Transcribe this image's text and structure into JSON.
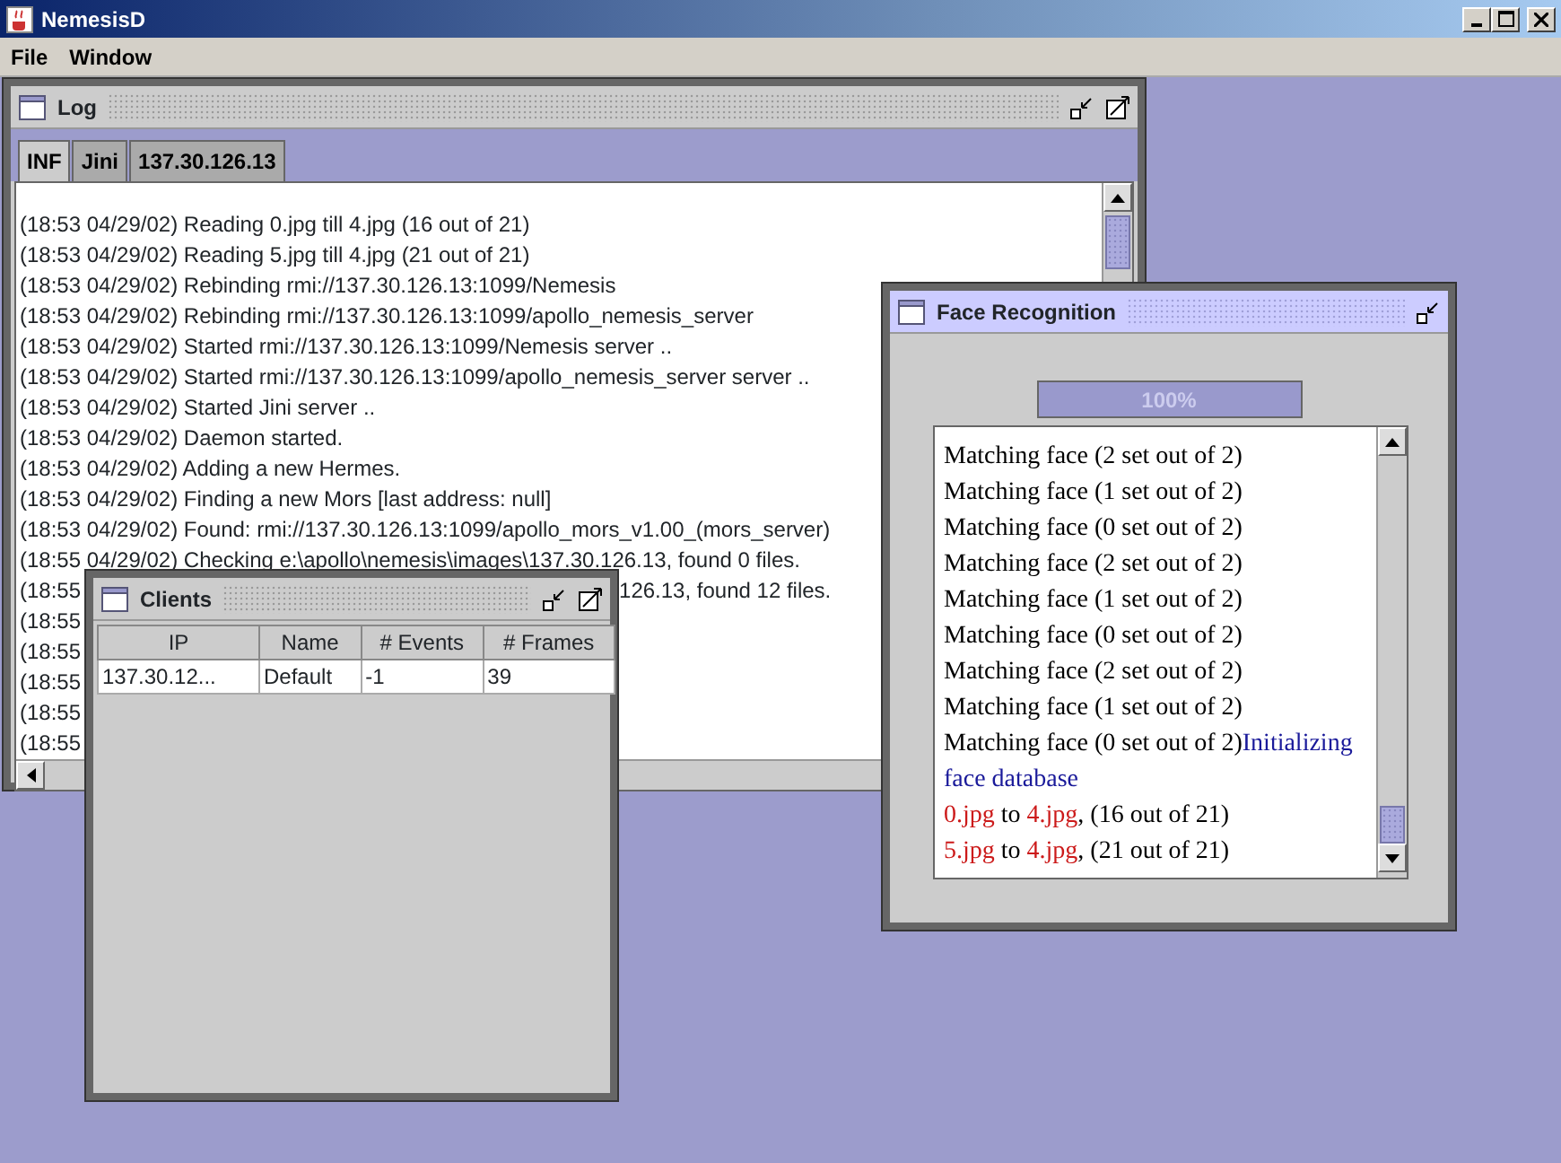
{
  "app": {
    "title": "NemesisD"
  },
  "menu": [
    "File",
    "Window"
  ],
  "log_window": {
    "title": "Log",
    "tabs": [
      {
        "label": "INF",
        "selected": true
      },
      {
        "label": "Jini",
        "selected": false
      },
      {
        "label": "137.30.126.13",
        "selected": false
      }
    ],
    "lines": [
      {
        "text": "(18:53 04/29/02) Reading 0.jpg till 4.jpg (16 out of 21)"
      },
      {
        "text": "(18:53 04/29/02) Reading 5.jpg till 4.jpg (21 out of 21)"
      },
      {
        "text": "(18:53 04/29/02) Rebinding rmi://137.30.126.13:1099/Nemesis"
      },
      {
        "text": "(18:53 04/29/02) Rebinding rmi://137.30.126.13:1099/apollo_nemesis_server"
      },
      {
        "text": "(18:53 04/29/02) Started rmi://137.30.126.13:1099/Nemesis server .."
      },
      {
        "text": "(18:53 04/29/02) Started rmi://137.30.126.13:1099/apollo_nemesis_server server .."
      },
      {
        "text": "(18:53 04/29/02) Started Jini server .."
      },
      {
        "text": "(18:53 04/29/02) Daemon started."
      },
      {
        "text": "(18:53 04/29/02) Adding a new Hermes."
      },
      {
        "text": "(18:53 04/29/02) Finding a new Mors [last address: null]"
      },
      {
        "text": "(18:53 04/29/02) Found: rmi://137.30.126.13:1099/apollo_mors_v1.00_(mors_server)"
      },
      {
        "text": "(18:55 04/29/02) Checking e:\\apollo\\nemesis\\images\\137.30.126.13, found 0 files."
      },
      {
        "text": "(18:55",
        "tail": "126.13, found 12 files."
      },
      {
        "text": "(18:55"
      },
      {
        "text": "(18:55"
      },
      {
        "text": "(18:55"
      },
      {
        "text": "(18:55"
      },
      {
        "text": "(18:55"
      }
    ]
  },
  "clients_window": {
    "title": "Clients",
    "columns": [
      "IP",
      "Name",
      "# Events",
      "# Frames"
    ],
    "rows": [
      [
        "137.30.12...",
        "Default",
        "-1",
        "39"
      ]
    ]
  },
  "face_window": {
    "title": "Face Recognition",
    "progress": {
      "level": 1,
      "label": "100%"
    },
    "messages": [
      {
        "segments": [
          {
            "text": "Matching face (2 set out of 2)",
            "color": "#000000"
          }
        ]
      },
      {
        "segments": [
          {
            "text": "Matching face (1 set out of 2)",
            "color": "#000000"
          }
        ]
      },
      {
        "segments": [
          {
            "text": "Matching face (0 set out of 2)",
            "color": "#000000"
          }
        ]
      },
      {
        "segments": [
          {
            "text": "Matching face (2 set out of 2)",
            "color": "#000000"
          }
        ]
      },
      {
        "segments": [
          {
            "text": "Matching face (1 set out of 2)",
            "color": "#000000"
          }
        ]
      },
      {
        "segments": [
          {
            "text": "Matching face (0 set out of 2)",
            "color": "#000000"
          }
        ]
      },
      {
        "segments": [
          {
            "text": "Matching face (2 set out of 2)",
            "color": "#000000"
          }
        ]
      },
      {
        "segments": [
          {
            "text": "Matching face (1 set out of 2)",
            "color": "#000000"
          }
        ]
      },
      {
        "segments": [
          {
            "text": "Matching face (0 set out of 2)",
            "color": "#000000"
          },
          {
            "text": "Initializing face database",
            "color": "#1a1a9a"
          }
        ]
      },
      {
        "segments": [
          {
            "text": "0.jpg",
            "color": "#cc1a1a"
          },
          {
            "text": " to ",
            "color": "#000000"
          },
          {
            "text": "4.jpg",
            "color": "#cc1a1a"
          },
          {
            "text": ", (16 out of 21)",
            "color": "#000000"
          }
        ]
      },
      {
        "segments": [
          {
            "text": "5.jpg",
            "color": "#cc1a1a"
          },
          {
            "text": " to ",
            "color": "#000000"
          },
          {
            "text": "4.jpg",
            "color": "#cc1a1a"
          },
          {
            "text": ", (21 out of 21)",
            "color": "#000000"
          }
        ]
      }
    ]
  }
}
